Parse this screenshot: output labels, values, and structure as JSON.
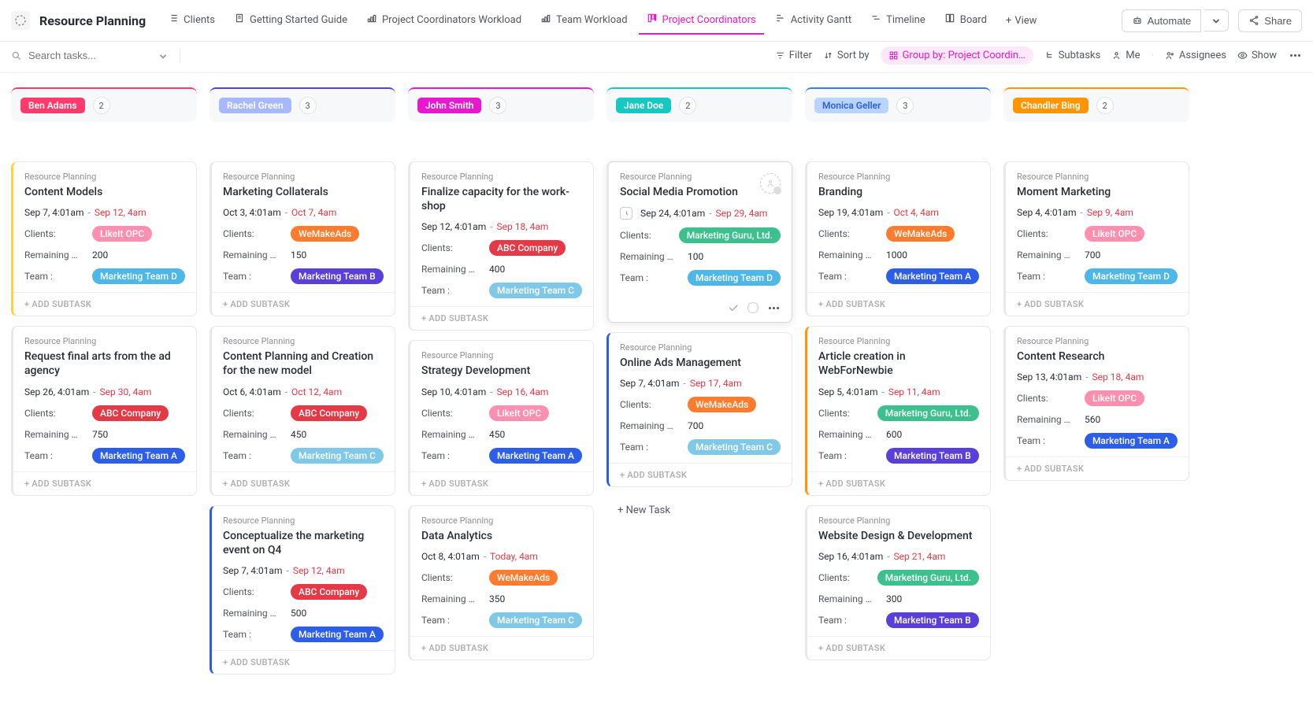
{
  "app": {
    "title": "Resource Planning"
  },
  "tabs": [
    {
      "label": "Clients"
    },
    {
      "label": "Getting Started Guide"
    },
    {
      "label": "Project Coordinators Workload"
    },
    {
      "label": "Team Workload"
    },
    {
      "label": "Project Coordinators",
      "active": true
    },
    {
      "label": "Activity Gantt"
    },
    {
      "label": "Timeline"
    },
    {
      "label": "Board"
    }
  ],
  "add_view": "View",
  "top_actions": {
    "automate": "Automate",
    "share": "Share"
  },
  "search": {
    "placeholder": "Search tasks..."
  },
  "filters": {
    "filter": "Filter",
    "sort": "Sort by",
    "group": "Group by: Project Coordin…",
    "subtasks": "Subtasks",
    "me": "Me",
    "assignees": "Assignees",
    "show": "Show"
  },
  "add_subtask": "+ ADD SUBTASK",
  "new_task": "+ New Task",
  "labels": {
    "clients": "Clients:",
    "remaining": "Remaining …",
    "team": "Team :"
  },
  "project_name": "Resource Planning",
  "client_tags": {
    "likeit": {
      "text": "LikeIt OPC",
      "bg": "#ff8fb1"
    },
    "abc": {
      "text": "ABC Company",
      "bg": "#e63946"
    },
    "wemakeads": {
      "text": "WeMakeAds",
      "bg": "#ff7b2e"
    },
    "guru": {
      "text": "Marketing Guru, Ltd.",
      "bg": "#3cc08e"
    }
  },
  "team_tags": {
    "a": {
      "text": "Marketing Team A",
      "bg": "#2c5ee8"
    },
    "b": {
      "text": "Marketing Team B",
      "bg": "#5a3fd8"
    },
    "c": {
      "text": "Marketing Team C",
      "bg": "#7fc8e8"
    },
    "d": {
      "text": "Marketing Team D",
      "bg": "#4db8e8"
    }
  },
  "columns": [
    {
      "name": "Ben Adams",
      "count": "2",
      "color": "#ff3b6b",
      "pill_bg": "#ff3b6b",
      "cards": [
        {
          "title": "Content Models",
          "border": "#ffd43b",
          "start": "Sep 7, 4:01am",
          "end": "Sep 12, 4am",
          "client": "likeit",
          "remaining": "200",
          "team": "d"
        },
        {
          "title": "Request final arts from the ad agency",
          "border": "#e8e8e8",
          "start": "Sep 26, 4:01am",
          "end": "Sep 30, 4am",
          "client": "abc",
          "remaining": "750",
          "team": "a"
        }
      ]
    },
    {
      "name": "Rachel Green",
      "count": "3",
      "color": "#5a3fd8",
      "pill_bg": "#a8b8ff",
      "cards": [
        {
          "title": "Marketing Collaterals",
          "border": "#e8e8e8",
          "start": "Oct 3, 4:01am",
          "end": "Oct 7, 4am",
          "client": "wemakeads",
          "remaining": "150",
          "team": "b"
        },
        {
          "title": "Content Planning and Creation for the new model",
          "border": "#e8e8e8",
          "start": "Oct 6, 4:01am",
          "end": "Oct 12, 4am",
          "client": "abc",
          "remaining": "450",
          "team": "c"
        },
        {
          "title": "Conceptualize the marketing event on Q4",
          "border": "#2c5ee8",
          "start": "Sep 7, 4:01am",
          "end": "Sep 12, 4am",
          "client": "abc",
          "remaining": "500",
          "team": "a"
        }
      ]
    },
    {
      "name": "John Smith",
      "count": "3",
      "color": "#e719cf",
      "pill_bg": "#e719cf",
      "cards": [
        {
          "title": "Finalize capacity for the work-shop",
          "border": "#e8e8e8",
          "start": "Sep 12, 4:01am",
          "end": "Sep 18, 4am",
          "client": "abc",
          "remaining": "400",
          "team": "c"
        },
        {
          "title": "Strategy Development",
          "border": "#e8e8e8",
          "start": "Sep 10, 4:01am",
          "end": "Sep 16, 4am",
          "client": "likeit",
          "remaining": "450",
          "team": "a"
        },
        {
          "title": "Data Analytics",
          "border": "#e8e8e8",
          "start": "Oct 8, 4:01am",
          "end": "Today, 4am",
          "client": "wemakeads",
          "remaining": "350",
          "team": "c"
        }
      ]
    },
    {
      "name": "Jane Doe",
      "count": "2",
      "color": "#19c7c2",
      "pill_bg": "#19c7c2",
      "cards": [
        {
          "title": "Social Media Promotion",
          "border": "#e8e8e8",
          "start": "Sep 24, 4:01am",
          "end": "Sep 29, 4am",
          "client": "guru",
          "remaining": "100",
          "team": "d",
          "hovered": true
        },
        {
          "title": "Online Ads Management",
          "border": "#2c5ee8",
          "start": "Sep 7, 4:01am",
          "end": "Sep 17, 4am",
          "client": "wemakeads",
          "remaining": "700",
          "team": "c"
        }
      ],
      "show_new_task": true
    },
    {
      "name": "Monica Geller",
      "count": "3",
      "color": "#3b7de8",
      "pill_bg": "#b8d4ff",
      "pill_fg": "#2c5ee8",
      "cards": [
        {
          "title": "Branding",
          "border": "#e8e8e8",
          "start": "Sep 19, 4:01am",
          "end": "Oct 4, 4am",
          "client": "wemakeads",
          "remaining": "1000",
          "team": "a"
        },
        {
          "title": "Article creation in WebForNewbie",
          "border": "#ff9500",
          "start": "Sep 5, 4:01am",
          "end": "Sep 11, 4am",
          "client": "guru",
          "remaining": "600",
          "team": "b"
        },
        {
          "title": "Website Design & Development",
          "border": "#e8e8e8",
          "start": "Sep 16, 4:01am",
          "end": "Sep 21, 4am",
          "client": "guru",
          "remaining": "300",
          "team": "b"
        }
      ]
    },
    {
      "name": "Chandler Bing",
      "count": "2",
      "color": "#ff9500",
      "pill_bg": "#ff9500",
      "cards": [
        {
          "title": "Moment Marketing",
          "border": "#e8e8e8",
          "start": "Sep 4, 4:01am",
          "end": "Sep 9, 4am",
          "client": "likeit",
          "remaining": "700",
          "team": "d"
        },
        {
          "title": "Content Research",
          "border": "#e8e8e8",
          "start": "Sep 13, 4:01am",
          "end": "Sep 18, 4am",
          "client": "likeit",
          "remaining": "560",
          "team": "a"
        }
      ]
    }
  ]
}
